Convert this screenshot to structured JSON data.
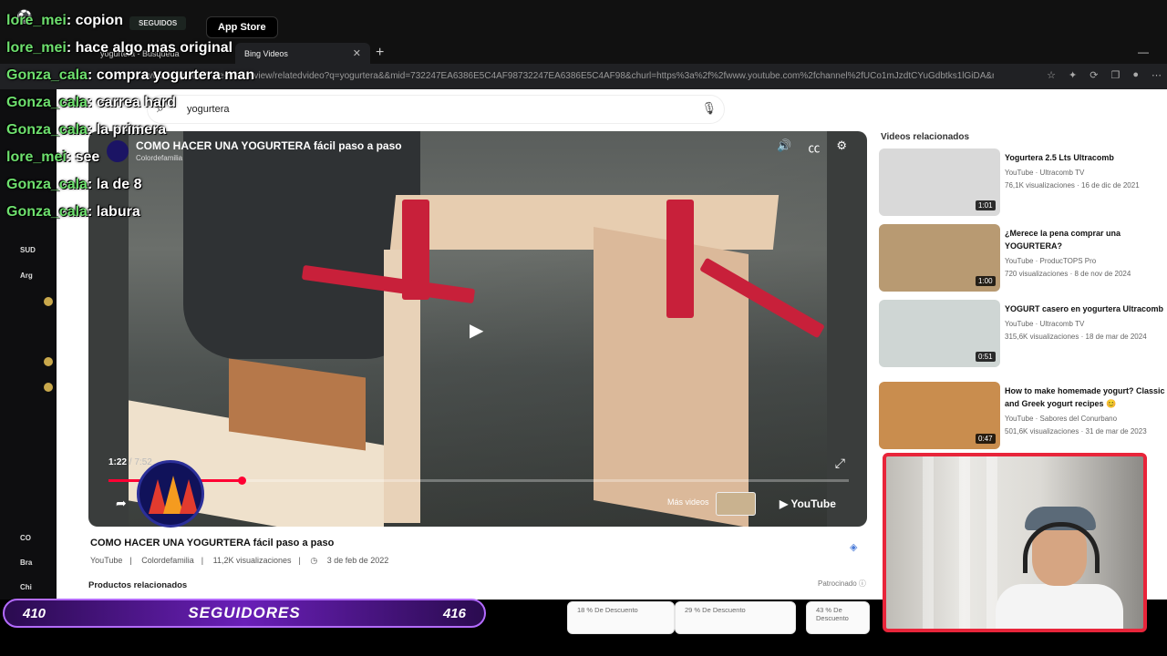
{
  "top": {
    "seguidos": "SEGUIDOS",
    "appstore": "App Store"
  },
  "tabs": [
    {
      "label": "yogurtera - Búsqueda"
    },
    {
      "label": "Bing Videos"
    }
  ],
  "address": {
    "url": "https://www.bing.com/videos/riverview/relatedvideo?q=yogurtera&&mid=732247EA6386E5C4AF98732247EA6386E5C4AF98&churl=https%3a%2f%2fwww.youtube.com%2fchannel%2fUCo1mJzdtCYuGdbtks1lGiDA&mcid=55DD21..."
  },
  "search": {
    "query": "yogurtera"
  },
  "player": {
    "title": "COMO HACER UNA YOGURTERA fácil paso a paso",
    "channel": "Colordefamilia",
    "current_time": "1:22",
    "duration": "/ 7:52",
    "progress": 0.18,
    "more_videos": "Más videos",
    "brand": "YouTube"
  },
  "video_info": {
    "title": "COMO HACER UNA YOGURTERA fácil paso a paso",
    "source": "YouTube",
    "channel": "Colordefamilia",
    "views": "11,2K visualizaciones",
    "date": "3 de feb de 2022"
  },
  "products": {
    "label": "Productos relacionados",
    "sponsored": "Patrocinado",
    "discounts": [
      "18 % De Descuento",
      "29 % De Descuento",
      "43 % De Descuento"
    ]
  },
  "related": {
    "header": "Videos relacionados",
    "items": [
      {
        "title": "Yogurtera 2.5 Lts Ultracomb",
        "source": "YouTube · Ultracomb TV",
        "views": "76,1K visualizaciones · 16 de dic de 2021",
        "duration": "1:01",
        "color": "#d9d9d9"
      },
      {
        "title": "¿Merece la pena comprar una YOGURTERA?",
        "source": "YouTube · ProducTOPS Pro",
        "views": "720 visualizaciones · 8 de nov de 2024",
        "duration": "1:00",
        "color": "#b89a72"
      },
      {
        "title": "YOGURT casero en yogurtera Ultracomb",
        "source": "YouTube · Ultracomb TV",
        "views": "315,6K visualizaciones · 18 de mar de 2024",
        "duration": "0:51",
        "color": "#cfd6d4"
      },
      {
        "title": "How to make homemade yogurt? Classic and Greek yogurt recipes 😊",
        "source": "YouTube · Sabores del Conurbano",
        "views": "501,6K visualizaciones · 31 de mar de 2023",
        "duration": "0:47",
        "color": "#c98d4e"
      }
    ]
  },
  "chat": [
    {
      "user": "lore_mei",
      "msg": ": copion"
    },
    {
      "user": "lore_mei",
      "msg": ": hace algo mas original"
    },
    {
      "user": "Gonza_cala",
      "msg": ": compra yogurtera man"
    },
    {
      "user": "Gonza_cala",
      "msg": ": carrea hard"
    },
    {
      "user": "Gonza_cala",
      "msg": ": la primera"
    },
    {
      "user": "lore_mei",
      "msg": ": see"
    },
    {
      "user": "Gonza_cala",
      "msg": ": la de 8"
    },
    {
      "user": "Gonza_cala",
      "msg": ": labura"
    }
  ],
  "followers": {
    "current": "410",
    "label": "SEGUIDORES",
    "goal": "416"
  },
  "colors": {
    "accent": "#ff0033",
    "chat_user": "#6ee06e",
    "followers_bar": "#6a1fb8",
    "webcam_border": "#e8253a"
  }
}
